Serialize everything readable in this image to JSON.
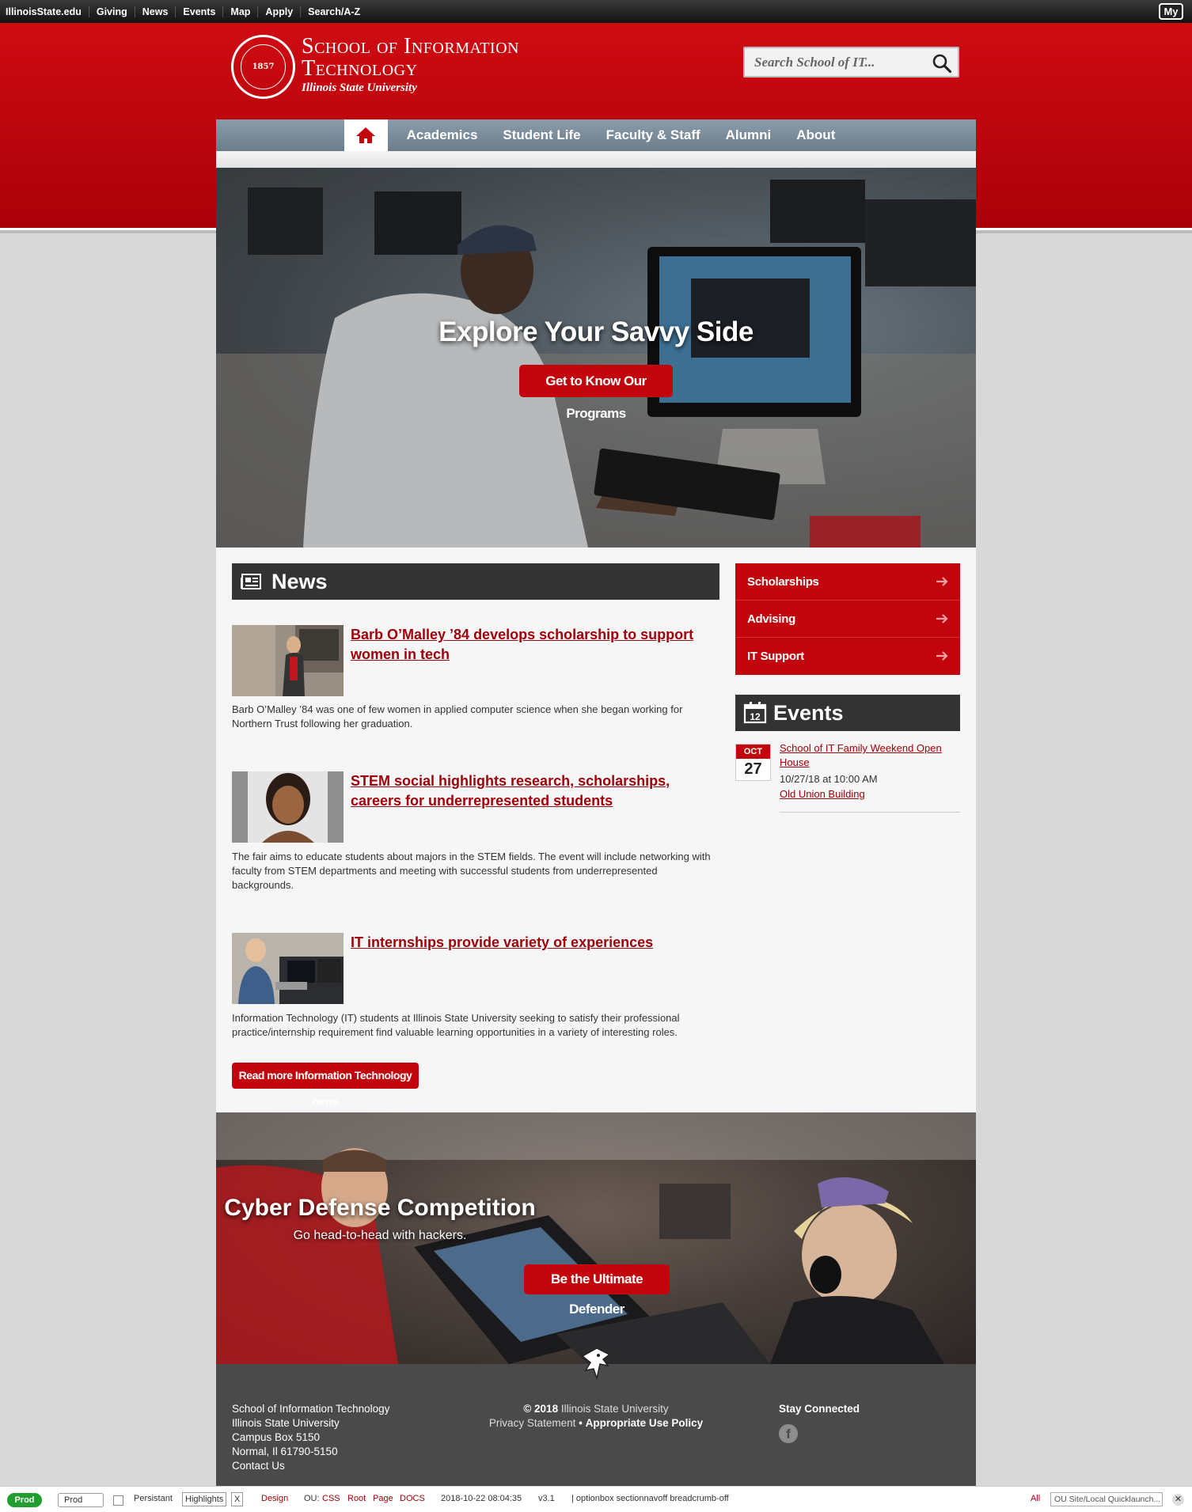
{
  "topbar": {
    "links": [
      "IllinoisState.edu",
      "Giving",
      "News",
      "Events",
      "Map",
      "Apply",
      "Search/A-Z"
    ],
    "my_label": "My"
  },
  "header": {
    "title_line1": "School of Information",
    "title_line2": "Technology",
    "subtitle": "Illinois State University",
    "seal_text": "1857",
    "search_placeholder": "Search School of IT..."
  },
  "nav": {
    "items": [
      "Academics",
      "Student Life",
      "Faculty & Staff",
      "Alumni",
      "About"
    ]
  },
  "hero": {
    "title": "Explore Your Savvy Side",
    "button": "Get to Know Our Programs"
  },
  "news": {
    "heading": "News",
    "items": [
      {
        "title": "Barb O’Malley ’84 develops scholarship to support women in tech",
        "desc": "Barb O’Malley ’84 was one of few women in applied computer science when she began working for Northern Trust following her graduation."
      },
      {
        "title": "STEM social highlights research, scholarships, careers for underrepresented students",
        "desc": "The fair aims to educate students about majors in the STEM fields. The event will include networking with faculty from STEM departments and meeting with successful students from underrepresented backgrounds."
      },
      {
        "title": "IT internships provide variety of experiences",
        "desc": "Information Technology (IT) students at Illinois State University seeking to satisfy their professional practice/internship requirement find valuable learning opportunities in a variety of interesting roles."
      }
    ],
    "more_button": "Read more Information Technology news"
  },
  "side_links": [
    "Scholarships",
    "Advising",
    "IT Support"
  ],
  "events": {
    "heading": "Events",
    "calendar_day": "12",
    "items": [
      {
        "month": "OCT",
        "day": "27",
        "title": "School of IT Family Weekend Open House",
        "time": "10/27/18 at 10:00 AM",
        "location": "Old Union Building"
      }
    ]
  },
  "cyber": {
    "title": "Cyber Defense Competition",
    "subtitle": "Go head-to-head with hackers.",
    "button": "Be the Ultimate Defender"
  },
  "footer": {
    "address": [
      "School of Information Technology",
      "Illinois State University",
      "Campus Box 5150",
      "Normal, Il 61790-5150",
      "Contact Us"
    ],
    "copyright_prefix": "© 2018",
    "copyright_org": "Illinois State University",
    "privacy": "Privacy Statement",
    "separator": "•",
    "policy": "Appropriate Use Policy",
    "stay_connected": "Stay Connected",
    "fb_glyph": "f"
  },
  "oubar": {
    "prod_badge": "Prod",
    "select_value": "Prod",
    "persistant": "Persistant",
    "highlights": "Highlights",
    "close_x": "X",
    "design": "Design",
    "ou_label": "OU:",
    "ou_links": [
      "CSS",
      "Root",
      "Page",
      "DOCS"
    ],
    "timestamp": "2018-10-22 08:04:35",
    "version": "v3.1",
    "classes": "| optionbox sectionnavoff breadcrumb-off",
    "all": "All",
    "quicklaunch": "OU Site/Local Quicklaunch...",
    "close_glyph": "✕"
  },
  "colors": {
    "brand_red": "#c2050d",
    "link_red": "#a0000a",
    "nav_slate": "#7b8c9a",
    "dark_panel": "#333333",
    "prod_green": "#219e2e"
  }
}
